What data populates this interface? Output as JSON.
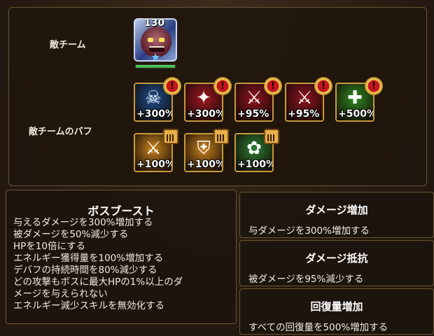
{
  "enemy_team": {
    "label": "敵チーム",
    "level": "130",
    "hp_fraction": 1.0
  },
  "buffs_label": "敵チームのバフ",
  "buffs_row1": [
    {
      "name": "boss-boost-icon",
      "value": "+300%",
      "bg": "#1b4f8f",
      "badge": "!"
    },
    {
      "name": "damage-up-icon",
      "value": "+300%",
      "bg": "#a11722",
      "badge": "!"
    },
    {
      "name": "damage-resist-icon",
      "value": "+95%",
      "bg": "#8e1220",
      "badge": "!"
    },
    {
      "name": "damage-resist-icon-2",
      "value": "+95%",
      "bg": "#8e1220",
      "badge": "!"
    },
    {
      "name": "heal-up-icon",
      "value": "+500%",
      "bg": "#2f8a22",
      "badge": "!"
    }
  ],
  "buffs_row2": [
    {
      "name": "crossed-swords-icon",
      "value": "+100%",
      "bg": "#c9831c"
    },
    {
      "name": "shield-icon",
      "value": "+100%",
      "bg": "#c9831c"
    },
    {
      "name": "paw-icon",
      "value": "+100%",
      "bg": "#2b7d33"
    }
  ],
  "tooltip": {
    "title": "ボスブースト",
    "lines": [
      "与えるダメージを300%増加する",
      "被ダメージを50%減少する",
      "HPを10倍にする",
      "エネルギー獲得量を100%増加する",
      "デバフの持続時間を80%減少する",
      "どの攻撃もボスに最大HPの1%以上のダ",
      "メージを与えられない",
      "エネルギー減少スキルを無効化する"
    ]
  },
  "cards": [
    {
      "title": "ダメージ増加",
      "desc": "与ダメージを300%増加する"
    },
    {
      "title": "ダメージ抵抗",
      "desc": "被ダメージを95%減少する"
    },
    {
      "title": "回復量増加",
      "desc": "すべての回復量を500%増加する"
    }
  ]
}
